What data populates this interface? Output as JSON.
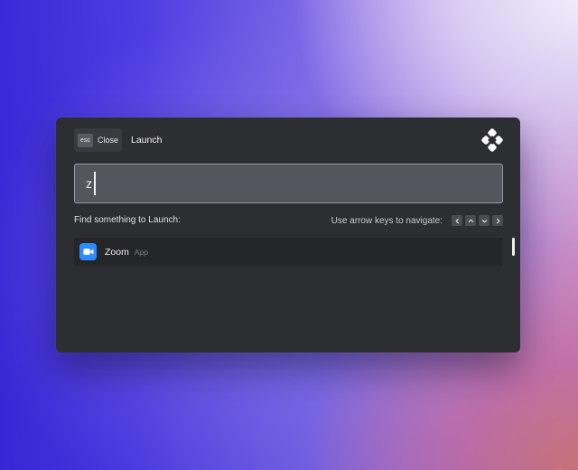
{
  "header": {
    "close_key": "esc",
    "close_label": "Close",
    "title": "Launch",
    "logo_icon": "raycast-style-logo-icon"
  },
  "search": {
    "value": "z"
  },
  "subhead": {
    "label": "Find something to Launch:",
    "nav_hint": "Use arrow keys to navigate:",
    "nav_keys": [
      "chevron-left-icon",
      "chevron-up-icon",
      "chevron-down-icon",
      "chevron-right-icon"
    ]
  },
  "results": [
    {
      "name": "Zoom",
      "type": "App",
      "icon": "zoom-camera-icon",
      "icon_color": "#2d8cff"
    }
  ],
  "colors": {
    "panel": "#2d2e32",
    "search_bg": "#53565d",
    "accent": "#2d8cff"
  }
}
